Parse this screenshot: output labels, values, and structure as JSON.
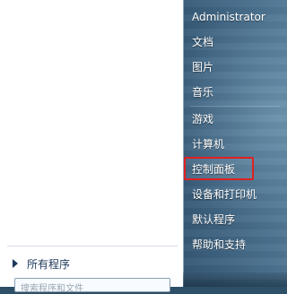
{
  "start_menu": {
    "left": {
      "all_programs_label": "所有程序",
      "search_placeholder": "搜索程序和文件"
    },
    "right": {
      "items": [
        {
          "label": "Administrator"
        },
        {
          "label": "文档"
        },
        {
          "label": "图片"
        },
        {
          "label": "音乐"
        },
        {
          "label": "游戏"
        },
        {
          "label": "计算机"
        },
        {
          "label": "控制面板"
        },
        {
          "label": "设备和打印机"
        },
        {
          "label": "默认程序"
        },
        {
          "label": "帮助和支持"
        }
      ],
      "highlighted_item": "控制面板",
      "highlight_color": "#e02020"
    }
  }
}
